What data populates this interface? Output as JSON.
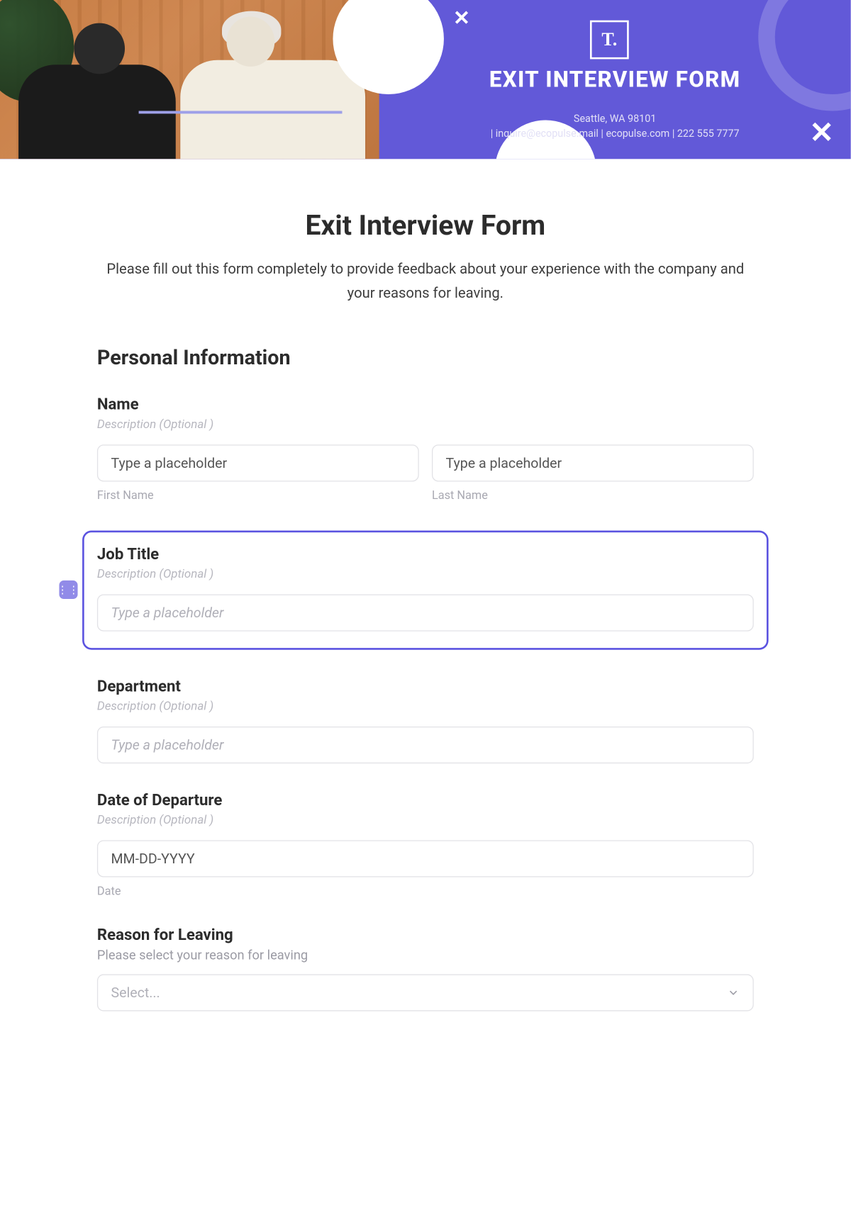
{
  "hero": {
    "logo_text": "T.",
    "banner_title": "EXIT INTERVIEW FORM",
    "address": "Seattle, WA 98101",
    "contact": "| inquire@ecopulse.mail |  ecopulse.com |  222 555 7777",
    "x_small": "✕",
    "x_big": "✕"
  },
  "form": {
    "title": "Exit Interview Form",
    "intro": "Please fill out this form completely to provide feedback about your experience with the company and your reasons for leaving.",
    "section_personal": "Personal Information"
  },
  "fields": {
    "name": {
      "label": "Name",
      "desc": "Description  (Optional )",
      "first_ph": "Type a placeholder",
      "first_sub": "First Name",
      "last_ph": "Type a placeholder",
      "last_sub": "Last Name"
    },
    "job": {
      "label": "Job Title",
      "desc": "Description  (Optional )",
      "ph": "Type a placeholder"
    },
    "dept": {
      "label": "Department",
      "desc": "Description  (Optional )",
      "ph": "Type a placeholder"
    },
    "date": {
      "label": "Date of Departure",
      "desc": "Description  (Optional )",
      "ph": "MM-DD-YYYY",
      "sub": "Date"
    },
    "reason": {
      "label": "Reason for Leaving",
      "sub": "Please select your reason for leaving",
      "ph": "Select..."
    }
  }
}
